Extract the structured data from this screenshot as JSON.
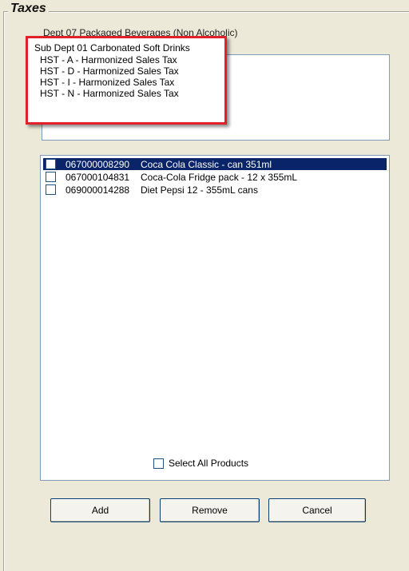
{
  "group": {
    "title": "Taxes"
  },
  "department": {
    "label": "Dept 07 Packaged Beverages (Non Alcoholic)"
  },
  "sub_department": {
    "label": "Sub Dept 01 Carbonated Soft Drinks"
  },
  "taxes": [
    {
      "label": "HST - A - Harmonized Sales Tax"
    },
    {
      "label": "HST - D - Harmonized Sales Tax"
    },
    {
      "label": "HST - I - Harmonized Sales Tax"
    },
    {
      "label": "HST - N - Harmonized Sales Tax"
    }
  ],
  "products": [
    {
      "code": "067000008290",
      "name": "Coca Cola Classic - can 351ml",
      "selected": true,
      "checked": false
    },
    {
      "code": "067000104831",
      "name": "Coca-Cola Fridge pack - 12 x 355mL",
      "selected": false,
      "checked": false
    },
    {
      "code": "069000014288",
      "name": "Diet Pepsi 12 - 355mL cans",
      "selected": false,
      "checked": false
    }
  ],
  "select_all": {
    "label": "Select All Products",
    "checked": false
  },
  "buttons": {
    "add": "Add",
    "remove": "Remove",
    "cancel": "Cancel"
  },
  "colors": {
    "highlight_border": "#e0212a",
    "selection": "#0a246a",
    "window_bg": "#ece9d8"
  }
}
